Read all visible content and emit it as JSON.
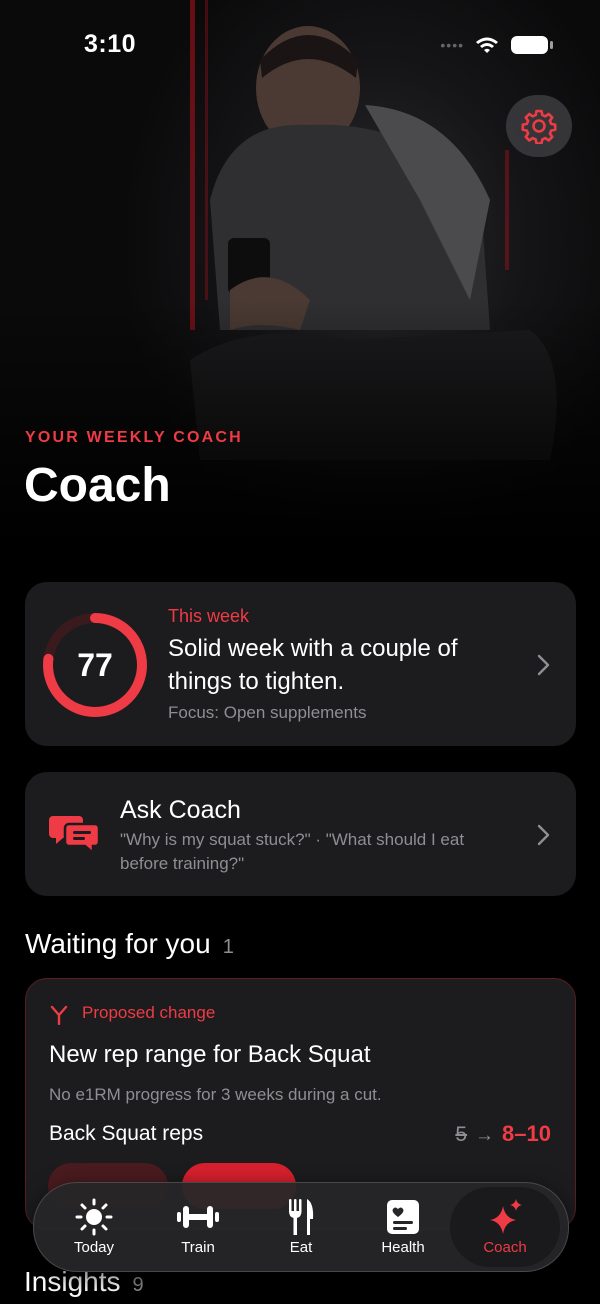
{
  "status_bar": {
    "time": "3:10"
  },
  "header": {
    "eyebrow": "YOUR WEEKLY COACH",
    "title": "Coach"
  },
  "weekly_card": {
    "score": "77",
    "score_fraction": 0.77,
    "label": "This week",
    "headline": "Solid week with a couple of things to tighten.",
    "focus": "Focus: Open supplements"
  },
  "ask_card": {
    "title": "Ask Coach",
    "examples": "\"Why is my squat stuck?\" · \"What should I eat before training?\""
  },
  "waiting": {
    "heading": "Waiting for you",
    "count": "1",
    "proposal": {
      "tag": "Proposed change",
      "title": "New rep range for Back Squat",
      "reason": "No e1RM progress for 3 weeks during a cut.",
      "metric_label": "Back Squat reps",
      "old_value": "5",
      "arrow": "→",
      "new_value": "8–10"
    }
  },
  "insights": {
    "heading": "Insights",
    "count": "9"
  },
  "tabbar": {
    "tabs": [
      {
        "label": "Today",
        "icon": "sun-icon"
      },
      {
        "label": "Train",
        "icon": "dumbbell-icon"
      },
      {
        "label": "Eat",
        "icon": "fork-knife-icon"
      },
      {
        "label": "Health",
        "icon": "health-card-icon"
      },
      {
        "label": "Coach",
        "icon": "sparkles-icon"
      }
    ],
    "active": "Coach"
  },
  "colors": {
    "accent": "#ef3b45",
    "card": "#1c1c1e",
    "background": "#000000"
  }
}
